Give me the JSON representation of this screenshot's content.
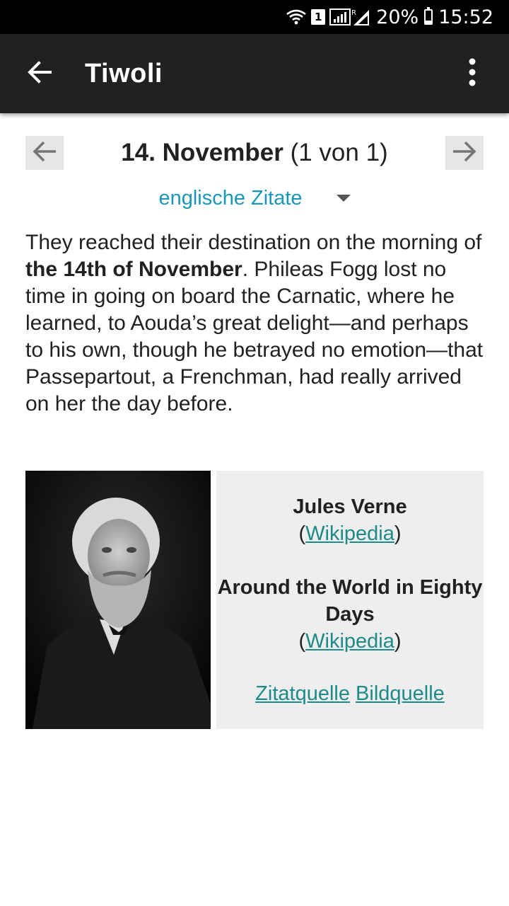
{
  "status_bar": {
    "sim_slot": "1",
    "battery_percent": "20%",
    "time": "15:52",
    "battery_level": 0.2
  },
  "app_bar": {
    "title": "Tiwoli",
    "back_icon": "arrow-left-icon",
    "menu_icon": "more-vert-icon"
  },
  "navigation": {
    "date": "14. November",
    "counter": "(1 von 1)",
    "prev_icon": "arrow-left-icon",
    "next_icon": "arrow-right-icon"
  },
  "category": {
    "selected": "englische Zitate"
  },
  "quote": {
    "before": "They reached their destination on the morning of ",
    "highlight": "the 14th of November",
    "after": ". Phileas Fogg lost no time in going on board the Carnatic, where he learned, to Aouda’s great delight—and perhaps to his own, though he betrayed no emotion—that Passepartout, a Frenchman, had really arrived on her the day before."
  },
  "attribution": {
    "author": "Jules Verne",
    "author_link": "Wikipedia",
    "work": "Around the World in Eighty Days",
    "work_link": "Wikipedia",
    "quote_source": "Zitatquelle",
    "image_source": "Bildquelle",
    "paren_open": "(",
    "paren_close": ")"
  },
  "colors": {
    "app_bar": "#212121",
    "accent": "#1a97b8",
    "link": "#1f8a8a"
  }
}
